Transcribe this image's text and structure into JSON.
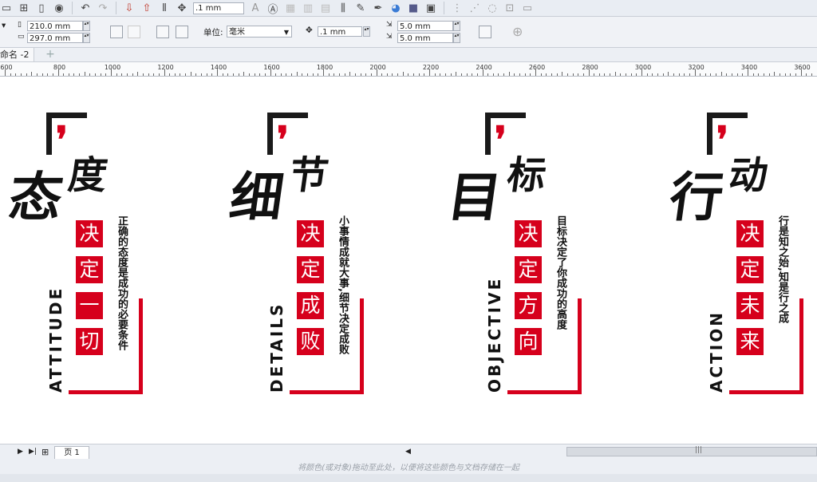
{
  "toolbar": {
    "icons": [
      "save-icon",
      "page-icon",
      "page-icon",
      "view-icon",
      "undo-icon",
      "redo-icon",
      "import-icon",
      "export-icon",
      "bars-icon",
      "nudge-icon",
      "text-icon",
      "glyph-icon",
      "fill-icon",
      "fill-icon",
      "fill-icon",
      "bars-icon",
      "pen-icon",
      "pen-icon",
      "color-icon",
      "square-icon",
      "pdf-icon"
    ],
    "nudge_value": ".1 mm"
  },
  "properties": {
    "width_value": "210.0 mm",
    "height_value": "297.0 mm",
    "units_label": "单位:",
    "units_value": "毫米",
    "nudge_value": ".1 mm",
    "dup_x_value": "5.0 mm",
    "dup_y_value": "5.0 mm"
  },
  "tabs": {
    "doc_tab_label": "命名 -2",
    "add_tab_symbol": "+"
  },
  "ruler": {
    "labels": [
      "600",
      "800",
      "1000",
      "1200",
      "1400",
      "1600",
      "1800",
      "2000",
      "2200",
      "2400",
      "2600",
      "2800",
      "3000",
      "3200",
      "3400",
      "3600"
    ]
  },
  "artwork": {
    "panels": [
      {
        "big1": "态",
        "big2": "度",
        "boxes": [
          "决",
          "定",
          "一",
          "切"
        ],
        "vertical": "正确的态度是成功的必要条件",
        "english": "ATTITUDE"
      },
      {
        "big1": "细",
        "big2": "节",
        "boxes": [
          "决",
          "定",
          "成",
          "败"
        ],
        "vertical": "小事情成就大事,细节决定成败",
        "english": "DETAILS"
      },
      {
        "big1": "目",
        "big2": "标",
        "boxes": [
          "决",
          "定",
          "方",
          "向"
        ],
        "vertical": "目标决定了你成功的高度",
        "english": "OBJECTIVE"
      },
      {
        "big1": "行",
        "big2": "动",
        "boxes": [
          "决",
          "定",
          "未",
          "来"
        ],
        "vertical": "行是知之始,知是行之成",
        "english": "ACTION"
      }
    ],
    "quote_symbol": "❜",
    "accent_color": "#d6001c"
  },
  "bottom": {
    "page_tab_label": "页 1",
    "hint_text": "将颜色(或对象)拖动至此处，以便将这些颜色与文档存储在一起"
  }
}
